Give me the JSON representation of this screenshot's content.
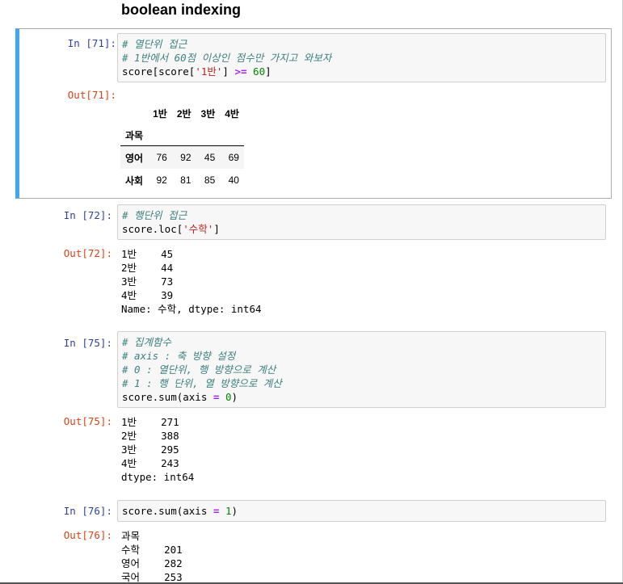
{
  "heading": "boolean indexing",
  "cells": {
    "c71": {
      "in_prompt": "In [71]:",
      "out_prompt": "Out[71]:",
      "code": {
        "line1": "# 열단위 접근",
        "line2": "# 1반에서 60점 이상인 점수만 가지고 와보자",
        "line3_a": "score[score[",
        "line3_str": "'1반'",
        "line3_b": "] ",
        "line3_op": ">=",
        "line3_c": " ",
        "line3_num": "60",
        "line3_d": "]"
      },
      "table": {
        "columns": [
          "1반",
          "2반",
          "3반",
          "4반"
        ],
        "index_name": "과목",
        "rows": [
          {
            "index": "영어",
            "values": [
              "76",
              "92",
              "45",
              "69"
            ]
          },
          {
            "index": "사회",
            "values": [
              "92",
              "81",
              "85",
              "40"
            ]
          }
        ]
      }
    },
    "c72": {
      "in_prompt": "In [72]:",
      "out_prompt": "Out[72]:",
      "code": {
        "line1": "# 행단위 접근",
        "line2_a": "score.loc[",
        "line2_str": "'수학'",
        "line2_b": "]"
      },
      "output": [
        "1반    45",
        "2반    44",
        "3반    73",
        "4반    39",
        "Name: 수학, dtype: int64"
      ]
    },
    "c75": {
      "in_prompt": "In [75]:",
      "out_prompt": "Out[75]:",
      "code": {
        "line1": "# 집계함수",
        "line2": "# axis : 축 방향 설정",
        "line3": "# 0 : 열단위, 행 방향으로 계산",
        "line4": "# 1 : 행 단위, 열 방향으로 계산",
        "line5_a": "score.sum(axis ",
        "line5_op": "=",
        "line5_b": " ",
        "line5_num": "0",
        "line5_c": ")"
      },
      "output": [
        "1반    271",
        "2반    388",
        "3반    295",
        "4반    243",
        "dtype: int64"
      ]
    },
    "c76": {
      "in_prompt": "In [76]:",
      "out_prompt": "Out[76]:",
      "code": {
        "line1_a": "score.sum(axis ",
        "line1_op": "=",
        "line1_b": " ",
        "line1_num": "1",
        "line1_c": ")"
      },
      "output": [
        "과목",
        "수학    201",
        "영어    282",
        "국어    253"
      ]
    }
  }
}
